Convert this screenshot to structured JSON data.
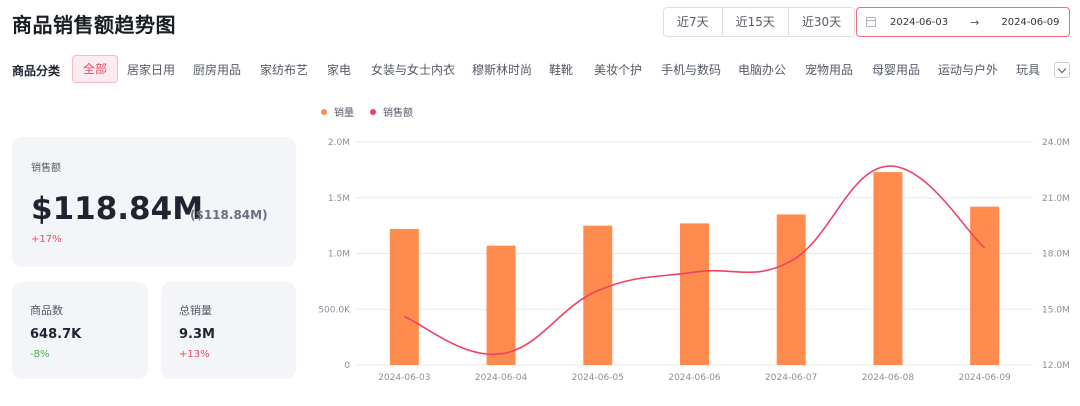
{
  "header": {
    "title": "商品销售额趋势图",
    "ranges": [
      "近7天",
      "近15天",
      "近30天"
    ],
    "date_start": "2024-06-03",
    "date_arrow": "→",
    "date_end": "2024-06-09"
  },
  "categories": {
    "label": "商品分类",
    "items": [
      "全部",
      "居家日用",
      "厨房用品",
      "家纺布艺",
      "家电",
      "女装与女士内衣",
      "穆斯林时尚",
      "鞋靴",
      "美妆个护",
      "手机与数码",
      "电脑办公",
      "宠物用品",
      "母婴用品",
      "运动与户外",
      "玩具"
    ],
    "active": "全部"
  },
  "stats": {
    "sales": {
      "label": "销售额",
      "value": "$118.84M",
      "sub": "($118.84M)",
      "change": "+17%"
    },
    "products": {
      "label": "商品数",
      "value": "648.7K",
      "change": "-8%"
    },
    "volume": {
      "label": "总销量",
      "value": "9.3M",
      "change": "+13%"
    }
  },
  "colors": {
    "bar": "#ff8c4e",
    "line": "#ee4266",
    "accent": "#f04864"
  },
  "chart_data": {
    "type": "bar",
    "legend": [
      "销量",
      "销售额"
    ],
    "legend_position": "top-left",
    "grid": true,
    "categories": [
      "2024-06-03",
      "2024-06-04",
      "2024-06-05",
      "2024-06-06",
      "2024-06-07",
      "2024-06-08",
      "2024-06-09"
    ],
    "series": [
      {
        "name": "销量",
        "type": "bar",
        "axis": "left",
        "values": [
          1220000,
          1070000,
          1250000,
          1270000,
          1350000,
          1730000,
          1420000
        ]
      },
      {
        "name": "销售额",
        "type": "line",
        "axis": "right",
        "values": [
          14.6,
          12.6,
          16.0,
          17.0,
          17.6,
          22.7,
          18.3
        ]
      }
    ],
    "y_left": {
      "ticks": [
        "0",
        "500.0K",
        "1.0M",
        "1.5M",
        "2.0M"
      ],
      "ylim": [
        0,
        2000000
      ]
    },
    "y_right": {
      "ticks": [
        "12.0M",
        "15.0M",
        "18.0M",
        "21.0M",
        "24.0M"
      ],
      "ylim": [
        12,
        24
      ]
    }
  }
}
